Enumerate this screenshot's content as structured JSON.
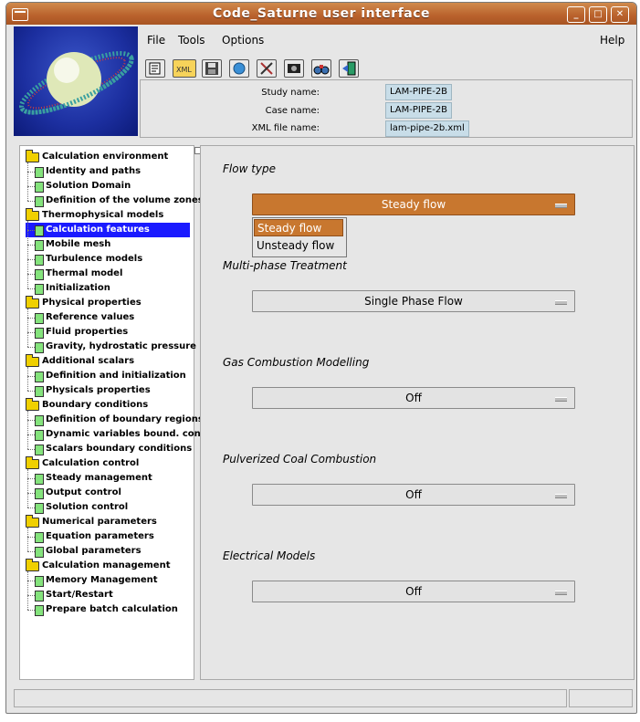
{
  "window": {
    "title": "Code_Saturne user interface"
  },
  "menubar": {
    "items": [
      {
        "label": "File"
      },
      {
        "label": "Tools"
      },
      {
        "label": "Options"
      }
    ],
    "help": "Help"
  },
  "toolbar": {
    "icons": [
      "new-file-icon",
      "open-xml-icon",
      "save-icon",
      "refresh-icon",
      "tools-icon",
      "video-icon",
      "binoculars-icon",
      "exit-icon"
    ]
  },
  "study": {
    "study_label": "Study name:",
    "study_value": "LAM-PIPE-2B",
    "case_label": "Case name:",
    "case_value": "LAM-PIPE-2B",
    "xml_label": "XML file name:",
    "xml_value": "lam-pipe-2b.xml"
  },
  "tree": {
    "sections": [
      {
        "label": "Calculation environment",
        "children": [
          "Identity and paths",
          "Solution Domain",
          "Definition of the volume zones"
        ]
      },
      {
        "label": "Thermophysical models",
        "children": [
          "Calculation features",
          "Mobile mesh",
          "Turbulence models",
          "Thermal model",
          "Initialization"
        ]
      },
      {
        "label": "Physical properties",
        "children": [
          "Reference values",
          "Fluid properties",
          "Gravity, hydrostatic pressure"
        ]
      },
      {
        "label": "Additional scalars",
        "children": [
          "Definition and initialization",
          "Physicals properties"
        ]
      },
      {
        "label": "Boundary conditions",
        "children": [
          "Definition of boundary regions",
          "Dynamic variables bound. cond.",
          "Scalars boundary conditions"
        ]
      },
      {
        "label": "Calculation control",
        "children": [
          "Steady management",
          "Output control",
          "Solution control"
        ]
      },
      {
        "label": "Numerical parameters",
        "children": [
          "Equation parameters",
          "Global parameters"
        ]
      },
      {
        "label": "Calculation management",
        "children": [
          "Memory Management",
          "Start/Restart",
          "Prepare batch calculation"
        ]
      }
    ],
    "selected": "Calculation features"
  },
  "main": {
    "flow_type": {
      "title": "Flow type",
      "value": "Steady flow",
      "options": [
        "Steady flow",
        "Unsteady flow"
      ]
    },
    "multiphase": {
      "title": "Multi-phase Treatment",
      "value": "Single Phase Flow"
    },
    "gas_combustion": {
      "title": "Gas Combustion Modelling",
      "value": "Off"
    },
    "coal_combustion": {
      "title": "Pulverized Coal Combustion",
      "value": "Off"
    },
    "electrical": {
      "title": "Electrical Models",
      "value": "Off"
    }
  },
  "colors": {
    "accent": "#c8772f",
    "selected": "#1a1aff",
    "folder": "#f0d000",
    "leaf": "#84e37c",
    "field": "#c8dde8"
  }
}
